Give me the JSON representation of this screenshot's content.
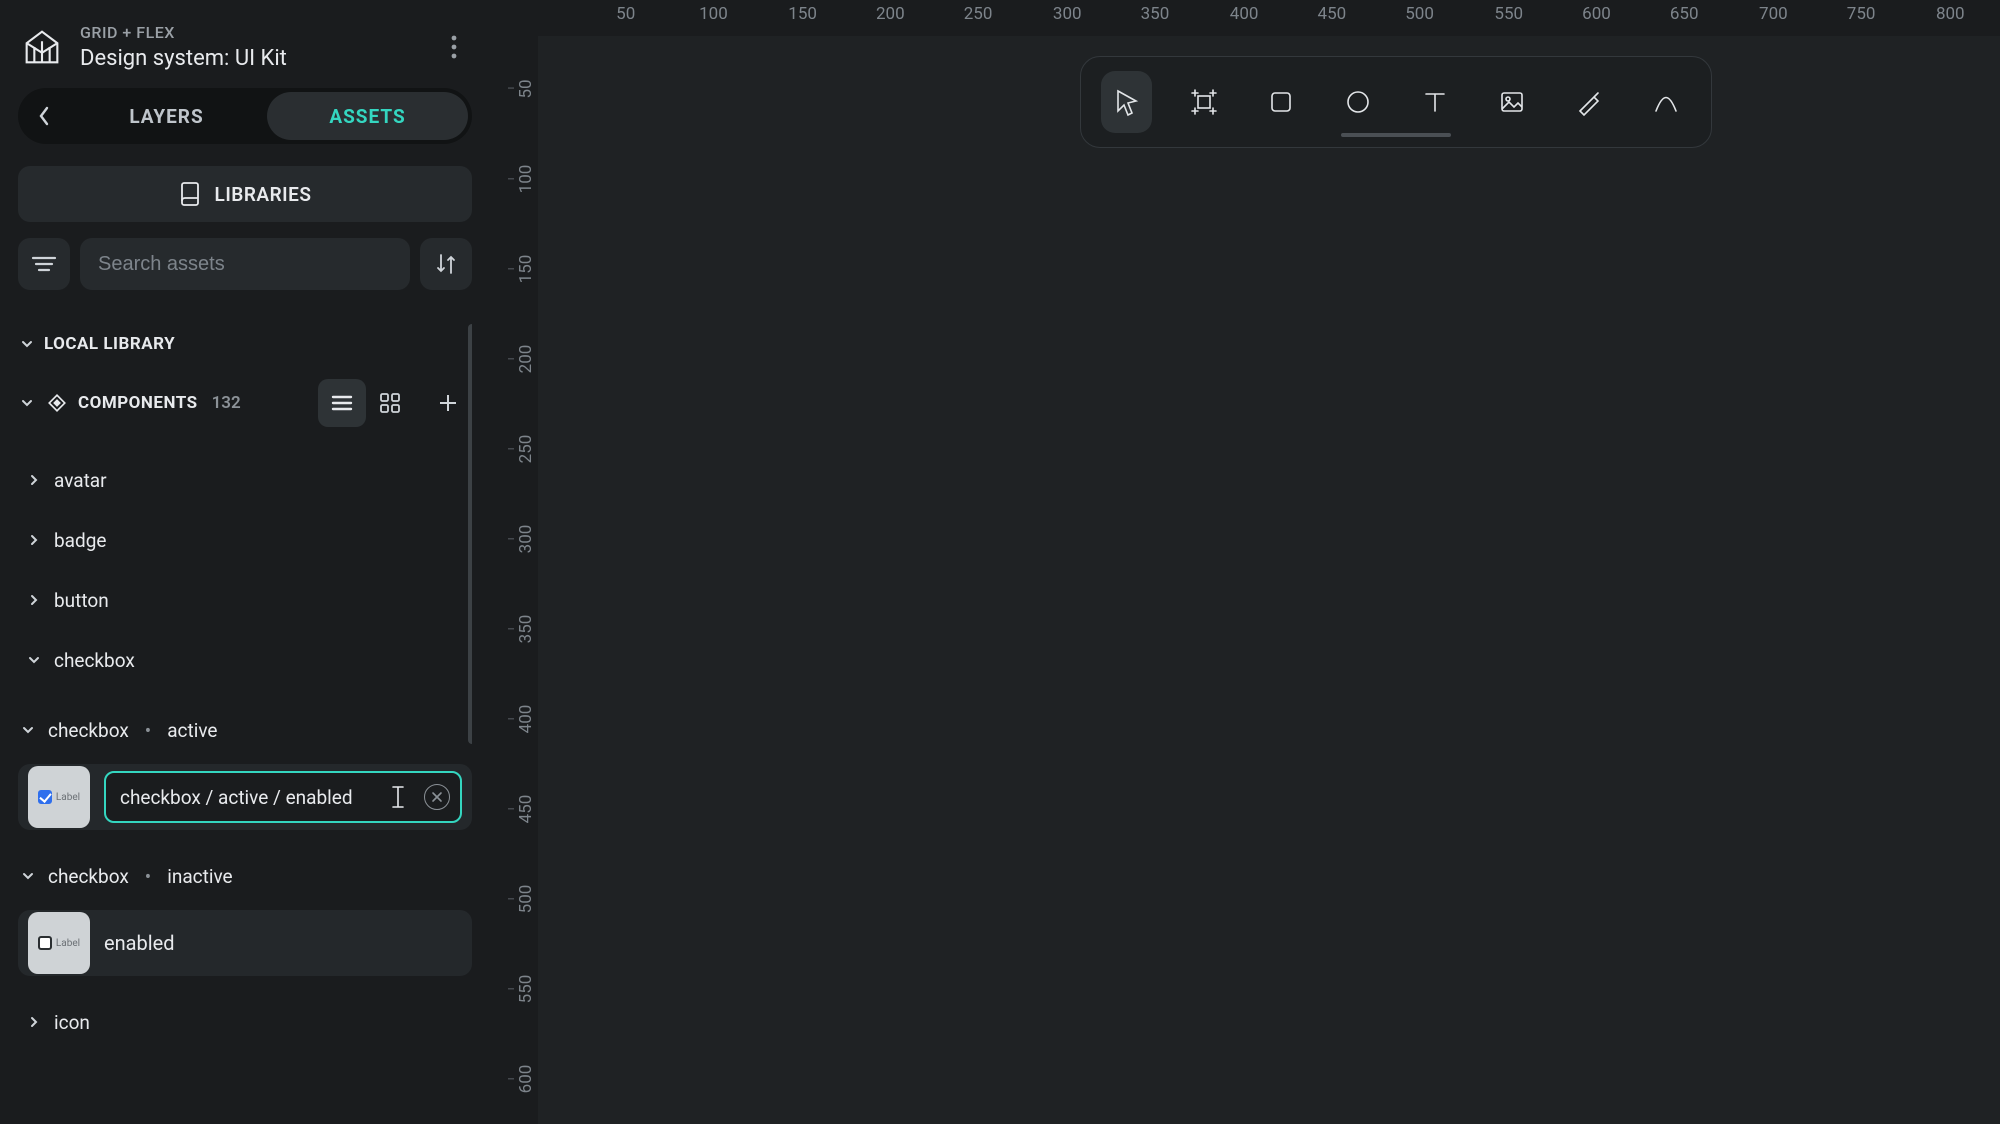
{
  "header": {
    "breadcrumb": "GRID + FLEX",
    "file_title": "Design system: UI Kit"
  },
  "tabs": {
    "layers": "LAYERS",
    "assets": "ASSETS"
  },
  "libraries_button": "LIBRARIES",
  "search": {
    "placeholder": "Search assets"
  },
  "local_library_label": "LOCAL LIBRARY",
  "components": {
    "label": "COMPONENTS",
    "count": "132"
  },
  "tree": {
    "avatar": "avatar",
    "badge": "badge",
    "button": "button",
    "checkbox": "checkbox",
    "checkbox_active_group_prefix": "checkbox",
    "checkbox_active_group_dot": "•",
    "checkbox_active_group_state": "active",
    "rename_value": "checkbox / active / enabled",
    "checkbox_inactive_group_prefix": "checkbox",
    "checkbox_inactive_group_dot": "•",
    "checkbox_inactive_group_state": "inactive",
    "inactive_leaf_label": "enabled",
    "icon": "icon",
    "thumb_label": "Label"
  },
  "ruler": {
    "h": [
      "50",
      "100",
      "150",
      "200",
      "250",
      "300",
      "350",
      "400",
      "450",
      "500",
      "550",
      "600",
      "650",
      "700",
      "750",
      "800"
    ],
    "v": [
      "50",
      "100",
      "150",
      "200",
      "250",
      "300",
      "350",
      "400",
      "450",
      "500",
      "550",
      "600"
    ]
  }
}
